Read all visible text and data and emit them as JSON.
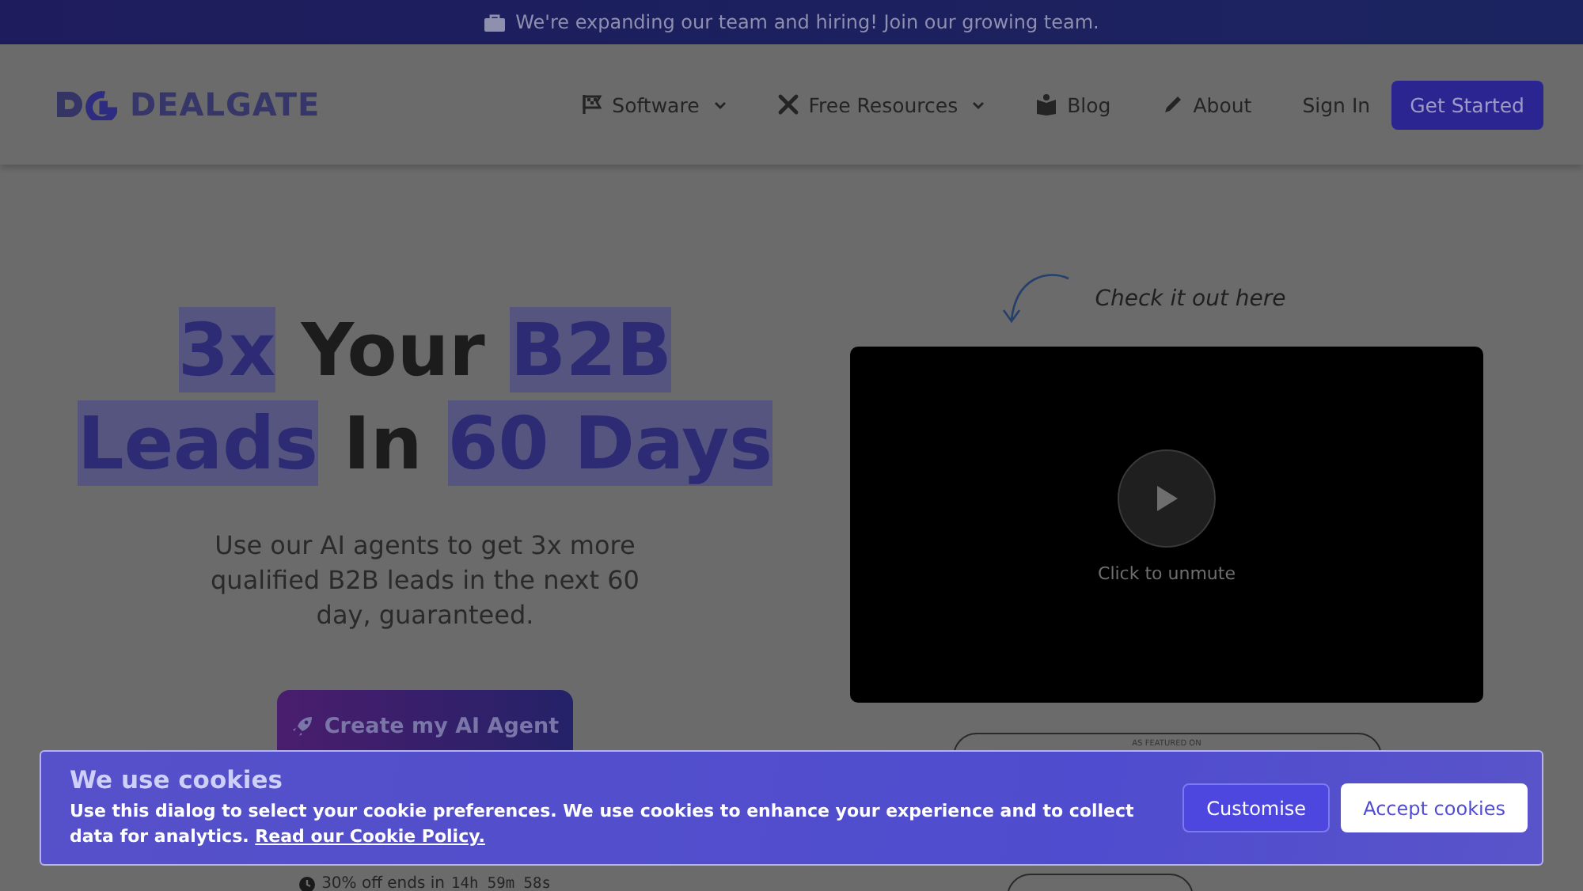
{
  "announcement": {
    "text": "We're expanding our team and hiring! Join our growing team."
  },
  "header": {
    "logo_text": "DEALGATE",
    "nav": [
      {
        "label": "Software",
        "dropdown": true
      },
      {
        "label": "Free Resources",
        "dropdown": true
      },
      {
        "label": "Blog",
        "dropdown": false
      },
      {
        "label": "About",
        "dropdown": false
      }
    ],
    "sign_in": "Sign In",
    "cta": "Get Started"
  },
  "hero": {
    "headline": [
      [
        {
          "text": "3x",
          "highlight": true
        },
        {
          "text": " Your ",
          "highlight": false
        },
        {
          "text": "B2B",
          "highlight": true
        }
      ],
      [
        {
          "text": "Leads",
          "highlight": true
        },
        {
          "text": " In ",
          "highlight": false
        },
        {
          "text": "60 Days",
          "highlight": true
        }
      ]
    ],
    "subtitle": "Use our AI agents to get 3x more qualified B2B leads in the next 60 day, guaranteed.",
    "button": "Create my AI Agent",
    "offer_text": "30% off ends in",
    "countdown": "14h 59m 58s"
  },
  "video": {
    "caption": "Check it out here",
    "overlay_text": "Click to unmute",
    "featured_label": "AS FEATURED ON"
  },
  "cookie_banner": {
    "title": "We use cookies",
    "body": "Use this dialog to select your cookie preferences. We use cookies to enhance your experience and to collect data for analytics.",
    "link": "Read our Cookie Policy.",
    "buttons": [
      {
        "label": "Customise",
        "kind": "secondary"
      },
      {
        "label": "Accept cookies",
        "kind": "primary"
      }
    ]
  }
}
